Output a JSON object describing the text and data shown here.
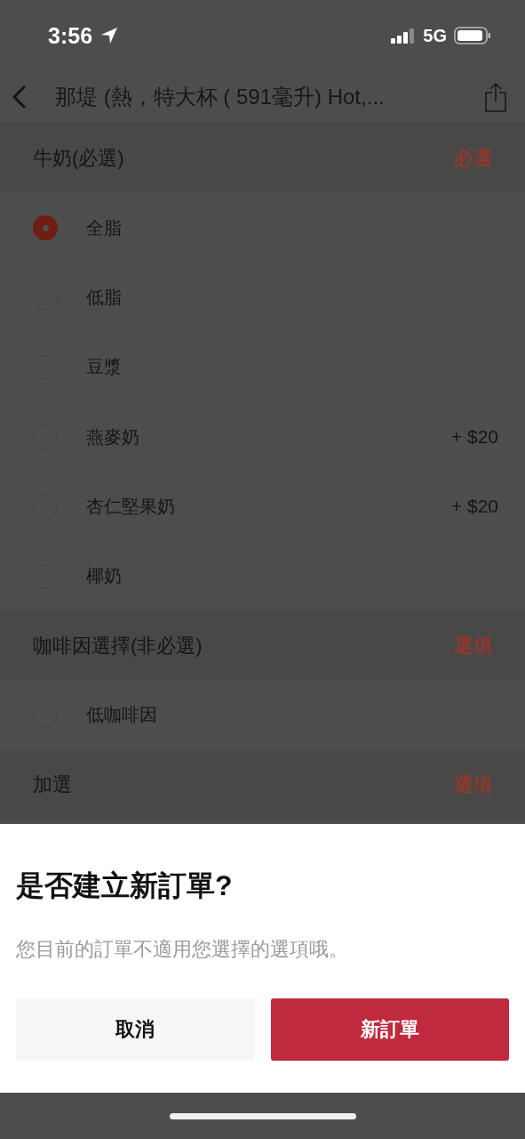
{
  "status_bar": {
    "time": "3:56",
    "network": "5G"
  },
  "nav": {
    "title": "那堤 (熱，特大杯 ( 591毫升) Hot,..."
  },
  "sections": [
    {
      "title": "牛奶(必選)",
      "tag": "必選",
      "options": [
        {
          "label": "全脂",
          "selected": true
        },
        {
          "label": "低脂",
          "selected": false
        },
        {
          "label": "豆漿",
          "selected": false
        },
        {
          "label": "燕麥奶",
          "price": "+ $20",
          "selected": false
        },
        {
          "label": "杏仁堅果奶",
          "price": "+ $20",
          "selected": false
        },
        {
          "label": "椰奶",
          "selected": false
        }
      ]
    },
    {
      "title": "咖啡因選擇(非必選)",
      "tag": "選填",
      "options": [
        {
          "label": "低咖啡因",
          "selected": false
        }
      ]
    },
    {
      "title": "加選",
      "tag": "選填"
    }
  ],
  "dialog": {
    "title": "是否建立新訂單?",
    "message": "您目前的訂單不適用您選擇的選項哦。",
    "buttons": [
      {
        "label": "取消",
        "kind": "secondary"
      },
      {
        "label": "新訂單",
        "kind": "primary"
      }
    ]
  }
}
